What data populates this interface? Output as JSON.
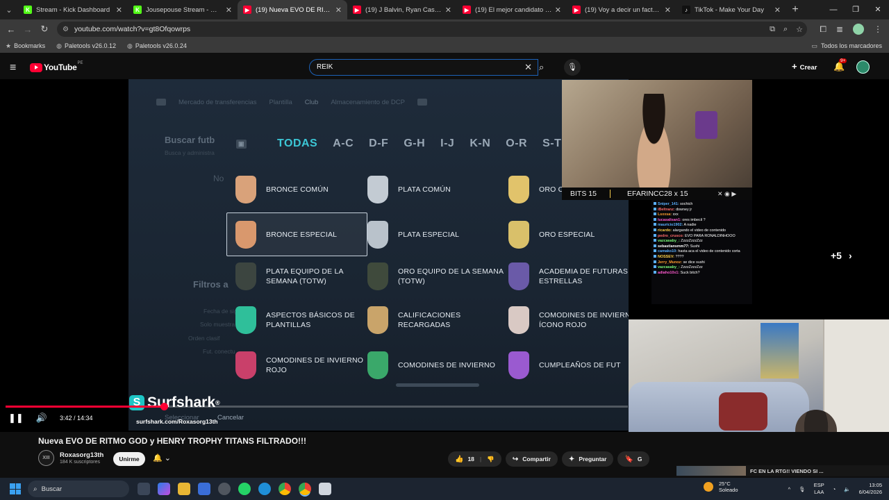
{
  "browser": {
    "tabs": [
      {
        "title": "Stream - Kick Dashboard",
        "fav": "K",
        "favcolor": "#53fc18",
        "active": false
      },
      {
        "title": "Jousepouse Stream - Watch Live",
        "fav": "K",
        "favcolor": "#53fc18",
        "active": false
      },
      {
        "title": "(19) Nueva EVO DE RITMO",
        "fav": "▶",
        "favcolor": "#ff0033",
        "active": true
      },
      {
        "title": "(19) J Balvin, Ryan Castro, DJ Snake",
        "fav": "▶",
        "favcolor": "#ff0033",
        "active": false
      },
      {
        "title": "(19) El mejor candidato - TIERLIST",
        "fav": "▶",
        "favcolor": "#ff0033",
        "active": false
      },
      {
        "title": "(19) Voy a decir un facto - YouTube",
        "fav": "▶",
        "favcolor": "#ff0033",
        "active": false
      },
      {
        "title": "TikTok - Make Your Day",
        "fav": "♪",
        "favcolor": "#111111",
        "active": false
      }
    ],
    "url": "youtube.com/watch?v=gt8Ofqowrps",
    "bookmarks": [
      "Bookmarks",
      "Paletools v26.0.12",
      "Paletools v26.0.24"
    ],
    "all_bookmarks": "Todos los marcadores"
  },
  "youtube": {
    "logo": "YouTube",
    "country": "PE",
    "search_value": "REIK",
    "create_label": "Crear",
    "notif_count": "9+"
  },
  "game": {
    "menu": [
      "Mercado de transferencias",
      "Plantilla",
      "Club",
      "Almacenamiento de DCP"
    ],
    "search_title": "Buscar futb",
    "search_sub": "Busca y administra",
    "filters_label": "Filtros a",
    "side_ghost": [
      "Fecha de sig",
      "Solo muestra",
      "Orden clasif",
      "Fut. conectu"
    ],
    "ghost_no": "No",
    "filter_tabs": [
      "TODAS",
      "A-C",
      "D-F",
      "G-H",
      "I-J",
      "K-N",
      "O-R",
      "S-T"
    ],
    "active_filter": "TODAS",
    "cards": [
      {
        "label": "BRONCE COMÚN",
        "color": "#d9a27a"
      },
      {
        "label": "PLATA COMÚN",
        "color": "#c3cbd3"
      },
      {
        "label": "ORO COMÚN",
        "color": "#e1c36b"
      },
      {
        "label": "BRONCE ESPECIAL",
        "color": "#d9986d"
      },
      {
        "label": "PLATA ESPECIAL",
        "color": "#b9c2cb"
      },
      {
        "label": "ORO ESPECIAL",
        "color": "#d9c06a"
      },
      {
        "label": "PLATA EQUIPO DE LA SEMANA (TOTW)",
        "color": "#3c4540"
      },
      {
        "label": "ORO EQUIPO DE LA SEMANA (TOTW)",
        "color": "#3f4a3c"
      },
      {
        "label": "ACADEMIA DE FUTURAS ESTRELLAS",
        "color": "#6a5aa8"
      },
      {
        "label": "ASPECTOS BÁSICOS DE PLANTILLAS",
        "color": "#2fbf9a"
      },
      {
        "label": "CALIFICACIONES RECARGADAS",
        "color": "#c9a46a"
      },
      {
        "label": "COMODINES DE INVIERNO ÍCONO ROJO",
        "color": "#d9c9c4"
      },
      {
        "label": "COMODINES DE INVIERNO ROJO",
        "color": "#c9406a"
      },
      {
        "label": "COMODINES DE INVIERNO",
        "color": "#3aa86a"
      },
      {
        "label": "CUMPLEAÑOS DE FUT",
        "color": "#9a5ad0"
      }
    ],
    "seleccionar": "Seleccionar",
    "cancelar": "Cancelar"
  },
  "overlay": {
    "bits": "BITS 15",
    "ticker": "EFARINCC28 x 15",
    "chat": [
      {
        "user": "Sniper_141:",
        "msg": "sochich",
        "color": "#5ab0ff"
      },
      {
        "user": "iBeltranz:",
        "msg": "downey jr",
        "color": "#ff6b6b"
      },
      {
        "user": "Lsxxsa:",
        "msg": "xxx",
        "color": "#ff9d2e"
      },
      {
        "user": "lucasalisan1:",
        "msg": "ores imbecil ?",
        "color": "#ff5ad0"
      },
      {
        "user": "mauricio1902:",
        "msg": "A nadie",
        "color": "#5ab0ff"
      },
      {
        "user": "ricardo:",
        "msg": "alargando el video de contenido",
        "color": "#ffd24a"
      },
      {
        "user": "pedro_crusco:",
        "msg": "EVO PARA RONALDINHOOO",
        "color": "#ff6b6b"
      },
      {
        "user": "vazcasaby_:",
        "msg": "ZzzzZzzzZzz",
        "color": "#7cff7c"
      },
      {
        "user": "sebastiansmm77:",
        "msg": "Sushi",
        "color": "#ffffff"
      },
      {
        "user": "camako10:",
        "msg": "hasta aca el video de contenido corta",
        "color": "#5ab0ff"
      },
      {
        "user": "NOSSEV:",
        "msg": "????",
        "color": "#ffd24a"
      },
      {
        "user": "Jerry_Munoz:",
        "msg": "se dice sushi",
        "color": "#ff9d2e"
      },
      {
        "user": "vazcasaby_:",
        "msg": "ZzzzZzzzZzz",
        "color": "#7cff7c"
      },
      {
        "user": "adiaho10x1:",
        "msg": "Suck bitch?",
        "color": "#ff5ad0"
      }
    ],
    "more": "+5"
  },
  "player": {
    "sponsor": "Surfshark",
    "sponsor_url": "surfshark.com/Roxasorg13th",
    "time": "3:42 / 14:34",
    "progress_fraction": 0.254
  },
  "video": {
    "title": "Nueva EVO DE RITMO GOD y HENRY TROPHY TITANS FILTRADO!!!",
    "channel": "Roxasorg13th",
    "subscribers": "184 K suscriptores",
    "join_label": "Unirme",
    "likes": "18",
    "share_label": "Compartir",
    "ask_label": "Preguntar",
    "save_label": "G"
  },
  "mini_preview": "FC EN LA RTG!! VIENDO SI ...",
  "taskbar": {
    "search": "Buscar",
    "weather_temp": "25°C",
    "weather_desc": "Soleado",
    "lang1": "ESP",
    "lang2": "LAA",
    "time": "13:05",
    "date": "6/04/2026"
  }
}
